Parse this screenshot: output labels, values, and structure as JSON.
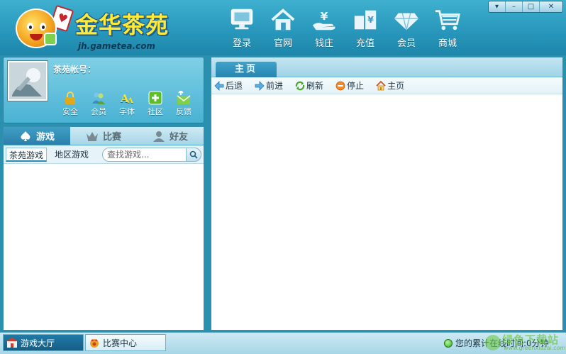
{
  "app": {
    "logo_title": "金华茶苑",
    "logo_url": "jh.gametea.com"
  },
  "top_nav": [
    {
      "label": "登录",
      "icon": "monitor-icon"
    },
    {
      "label": "官网",
      "icon": "house-icon"
    },
    {
      "label": "钱庄",
      "icon": "money-hand-icon"
    },
    {
      "label": "充值",
      "icon": "recharge-icon"
    },
    {
      "label": "会员",
      "icon": "diamond-icon"
    },
    {
      "label": "商城",
      "icon": "cart-icon"
    }
  ],
  "window_controls": [
    "▾",
    "–",
    "□",
    "✕"
  ],
  "user": {
    "account_label": "茶苑帐号：",
    "tools": [
      {
        "label": "安全",
        "icon": "lock-icon"
      },
      {
        "label": "会员",
        "icon": "members-icon"
      },
      {
        "label": "字体",
        "icon": "font-icon"
      },
      {
        "label": "社区",
        "icon": "community-plus-icon"
      },
      {
        "label": "反馈",
        "icon": "feedback-mail-icon"
      }
    ]
  },
  "game_panel": {
    "tabs": [
      {
        "label": "游戏",
        "icon": "spade-icon"
      },
      {
        "label": "比赛",
        "icon": "crown-icon"
      },
      {
        "label": "好友",
        "icon": "person-icon"
      }
    ],
    "subtabs": [
      "茶苑游戏",
      "地区游戏"
    ],
    "search_placeholder": "查找游戏..."
  },
  "browser": {
    "tab_label": "主页",
    "toolbar": [
      {
        "label": "后退",
        "icon": "back-arrow-icon"
      },
      {
        "label": "前进",
        "icon": "forward-arrow-icon"
      },
      {
        "label": "刷新",
        "icon": "refresh-icon"
      },
      {
        "label": "停止",
        "icon": "stop-icon"
      },
      {
        "label": "主页",
        "icon": "home-icon"
      }
    ]
  },
  "bottom": {
    "tabs": [
      {
        "label": "游戏大厅",
        "icon": "lobby-icon"
      },
      {
        "label": "比赛中心",
        "icon": "match-center-icon"
      }
    ],
    "status_text": "您的累计在线时间:0分钟"
  },
  "watermark": {
    "text": "绿色下载站",
    "url": "www.greenxiazai.com"
  },
  "colors": {
    "header": "#2796ba",
    "accent": "#2b80aa",
    "logo_yellow": "#ffe93a"
  }
}
